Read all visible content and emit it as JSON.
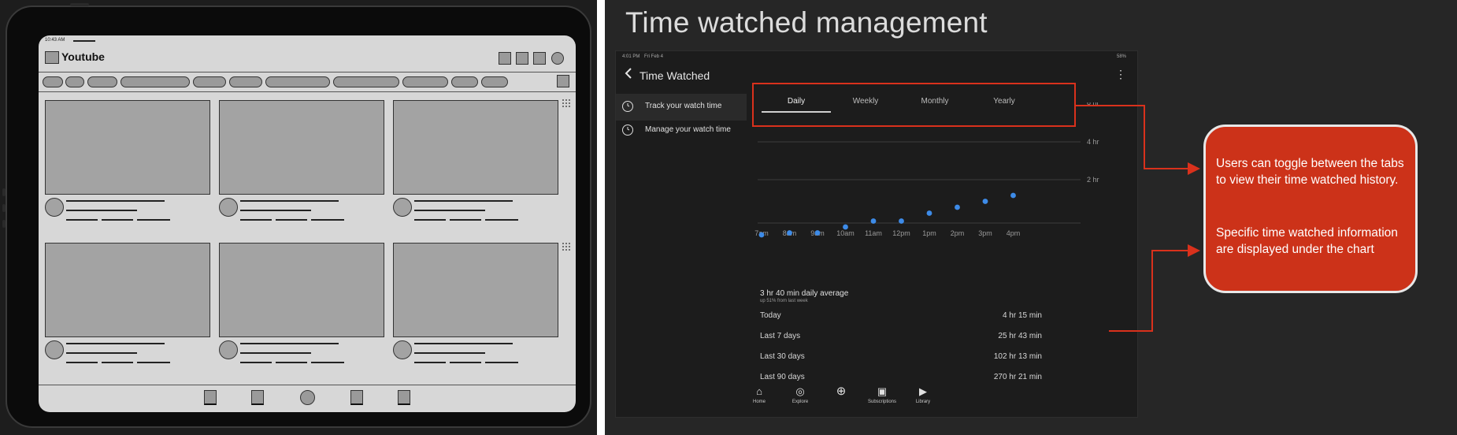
{
  "wireframe": {
    "status_time": "10:43 AM",
    "app_title": "Youtube"
  },
  "slide": {
    "title": "Time watched management"
  },
  "phone": {
    "status_time": "4:01 PM",
    "status_date": "Fri Feb 4",
    "status_battery": "58%",
    "header_title": "Time Watched",
    "back_icon": "chevron-left-icon",
    "menu_icon": "more-vert-icon",
    "sidebar": [
      {
        "label": "Track your watch time",
        "icon": "clock-icon",
        "active": true
      },
      {
        "label": "Manage your watch time",
        "icon": "timer-add-icon",
        "active": false
      }
    ],
    "tabs": [
      {
        "label": "Daily",
        "active": true
      },
      {
        "label": "Weekly",
        "active": false
      },
      {
        "label": "Monthly",
        "active": false
      },
      {
        "label": "Yearly",
        "active": false
      }
    ],
    "summary": {
      "main": "3 hr 40 min daily average",
      "sub": "up 51% from last week"
    },
    "stats": [
      {
        "label": "Today",
        "value": "4 hr 15 min"
      },
      {
        "label": "Last 7 days",
        "value": "25 hr 43 min"
      },
      {
        "label": "Last 30 days",
        "value": "102 hr 13 min"
      },
      {
        "label": "Last 90 days",
        "value": "270 hr 21 min"
      }
    ],
    "bottom_nav": [
      {
        "label": "Home",
        "icon": "home-icon"
      },
      {
        "label": "Explore",
        "icon": "compass-icon"
      },
      {
        "label": "",
        "icon": "add-circle-icon"
      },
      {
        "label": "Subscriptions",
        "icon": "subscriptions-icon"
      },
      {
        "label": "Library",
        "icon": "library-icon"
      }
    ]
  },
  "annotation": {
    "paragraph_1": "Users can toggle between the tabs to view their time watched history.",
    "paragraph_2": "Specific time watched information are displayed under the chart"
  },
  "colors": {
    "accent_red": "#cc3219",
    "outline_red": "#d9311c",
    "dot_blue": "#3d8be8"
  },
  "chart_data": {
    "type": "scatter",
    "categories": [
      "7am",
      "8am",
      "9am",
      "10am",
      "11am",
      "12pm",
      "1pm",
      "2pm",
      "3pm",
      "4pm"
    ],
    "values": [
      0.2,
      0.3,
      0.3,
      0.6,
      0.9,
      0.9,
      1.3,
      1.6,
      1.9,
      2.2
    ],
    "y_ticks": [
      {
        "value": 2,
        "label": "2 hr"
      },
      {
        "value": 4,
        "label": "4 hr"
      },
      {
        "value": 8,
        "label": "8 hr"
      }
    ],
    "grid": true
  }
}
